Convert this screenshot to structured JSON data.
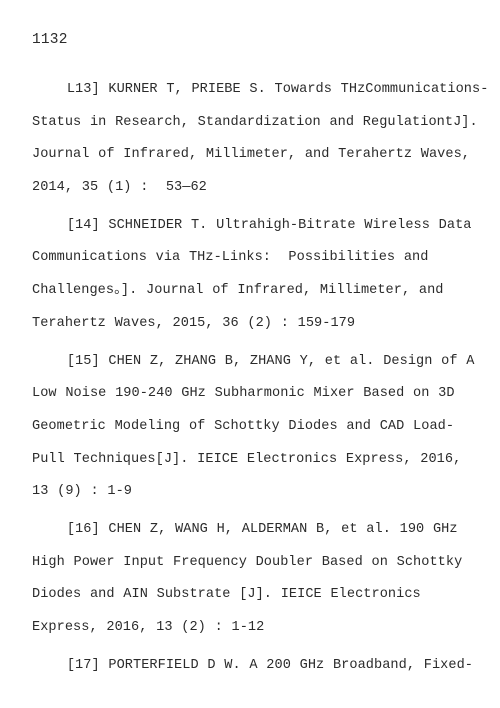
{
  "page": {
    "number": "1132"
  },
  "references": [
    {
      "id": "ref-13",
      "lines": [
        "    L13] KURNER T, PRIEBE S. Towards THzCommunications-",
        "Status in Research, Standardization and RegulationtJ].",
        "Journal of Infrared, Millimeter, and Terahertz Waves,",
        "2014, 35 (1) :  53—62"
      ]
    },
    {
      "id": "ref-14",
      "lines": [
        "    [14] SCHNEIDER T. Ultrahigh-Bitrate Wireless Data",
        "Communications via THz-Links:  Possibilities and",
        "Challenges。]. Journal of Infrared, Millimeter, and",
        "Terahertz Waves, 2015, 36 (2) : 159-179"
      ]
    },
    {
      "id": "ref-15",
      "lines": [
        "    [15] CHEN Z, ZHANG B, ZHANG Y, et al. Design of A",
        "Low Noise 190-240 GHz Subharmonic Mixer Based on 3D",
        "Geometric Modeling of Schottky Diodes and CAD Load-",
        "Pull Techniques[J]. IEICE Electronics Express, 2016,",
        "13 (9) : 1-9"
      ]
    },
    {
      "id": "ref-16",
      "lines": [
        "    [16] CHEN Z, WANG H, ALDERMAN B, et al. 190 GHz",
        "High Power Input Frequency Doubler Based on Schottky",
        "Diodes and AIN Substrate [J]. IEICE Electronics",
        "Express, 2016, 13 (2) : 1-12"
      ]
    },
    {
      "id": "ref-17",
      "lines": [
        "    [17] PORTERFIELD D W. A 200 GHz Broadband, Fixed-"
      ]
    }
  ]
}
